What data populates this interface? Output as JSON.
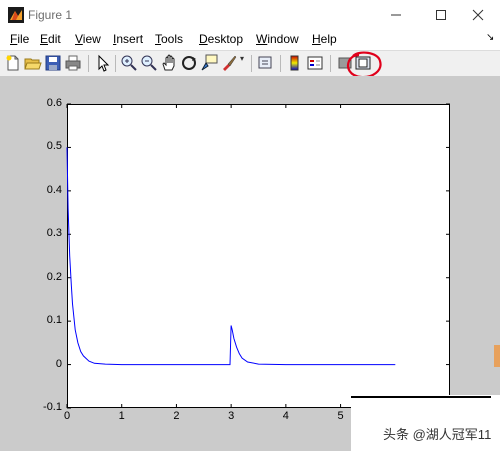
{
  "window": {
    "title": "Figure 1"
  },
  "menu": {
    "items": [
      {
        "label": "File",
        "underline": "F"
      },
      {
        "label": "Edit",
        "underline": "E"
      },
      {
        "label": "View",
        "underline": "V"
      },
      {
        "label": "Insert",
        "underline": "I"
      },
      {
        "label": "Tools",
        "underline": "T"
      },
      {
        "label": "Desktop",
        "underline": "D"
      },
      {
        "label": "Window",
        "underline": "W"
      },
      {
        "label": "Help",
        "underline": "H"
      }
    ]
  },
  "toolbar": {
    "icons": [
      "new-figure-icon",
      "open-file-icon",
      "save-icon",
      "print-icon",
      "edit-plot-icon",
      "zoom-in-icon",
      "zoom-out-icon",
      "pan-icon",
      "rotate-3d-icon",
      "data-cursor-icon",
      "brush-icon",
      "link-plot-icon",
      "insert-colorbar-icon",
      "insert-legend-icon",
      "hide-plot-tools-icon",
      "show-plot-tools-icon"
    ],
    "highlight": "show-plot-tools-icon"
  },
  "chart_data": {
    "type": "line",
    "title": "",
    "xlabel": "",
    "ylabel": "",
    "xlim": [
      0,
      7
    ],
    "ylim": [
      -0.1,
      0.6
    ],
    "xticks": [
      "0",
      "1",
      "2",
      "3",
      "4",
      "5"
    ],
    "yticks": [
      "0.6",
      "0.5",
      "0.4",
      "0.3",
      "0.2",
      "0.1",
      "0",
      "-0.1"
    ],
    "series": [
      {
        "color": "#0000ff",
        "x": [
          0,
          0.02,
          0.05,
          0.08,
          0.1,
          0.15,
          0.2,
          0.25,
          0.3,
          0.4,
          0.5,
          0.7,
          1.0,
          1.5,
          2.0,
          2.5,
          2.98,
          3.0,
          3.02,
          3.05,
          3.1,
          3.15,
          3.2,
          3.3,
          3.5,
          4.0,
          5.0,
          6.0
        ],
        "y": [
          0.5,
          0.36,
          0.25,
          0.18,
          0.14,
          0.08,
          0.05,
          0.03,
          0.02,
          0.008,
          0.003,
          0.001,
          0,
          0,
          0,
          0,
          0,
          0.09,
          0.08,
          0.06,
          0.04,
          0.025,
          0.015,
          0.006,
          0.001,
          0,
          0,
          0
        ]
      }
    ]
  },
  "watermark": "头条 @湖人冠军11",
  "colors": {
    "figure_bg": "#cbcbcb",
    "line": "#0000ff",
    "annotation": "#e0001b"
  }
}
